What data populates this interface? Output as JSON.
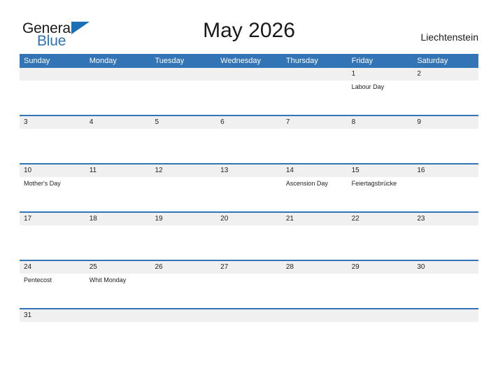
{
  "brand": {
    "word_one": "General",
    "word_two": "Blue",
    "triangle_icon": "triangle-right-icon",
    "blue_hex": "#2b73b8",
    "header_blue_hex": "#3274b6"
  },
  "header": {
    "title": "May 2026",
    "region": "Liechtenstein"
  },
  "calendar": {
    "weekday_headers": [
      "Sunday",
      "Monday",
      "Tuesday",
      "Wednesday",
      "Thursday",
      "Friday",
      "Saturday"
    ],
    "weeks": [
      {
        "days": [
          {
            "num": "",
            "events": ""
          },
          {
            "num": "",
            "events": ""
          },
          {
            "num": "",
            "events": ""
          },
          {
            "num": "",
            "events": ""
          },
          {
            "num": "",
            "events": ""
          },
          {
            "num": "1",
            "events": "Labour Day"
          },
          {
            "num": "2",
            "events": ""
          }
        ]
      },
      {
        "days": [
          {
            "num": "3",
            "events": ""
          },
          {
            "num": "4",
            "events": ""
          },
          {
            "num": "5",
            "events": ""
          },
          {
            "num": "6",
            "events": ""
          },
          {
            "num": "7",
            "events": ""
          },
          {
            "num": "8",
            "events": ""
          },
          {
            "num": "9",
            "events": ""
          }
        ]
      },
      {
        "days": [
          {
            "num": "10",
            "events": "Mother's Day"
          },
          {
            "num": "11",
            "events": ""
          },
          {
            "num": "12",
            "events": ""
          },
          {
            "num": "13",
            "events": ""
          },
          {
            "num": "14",
            "events": "Ascension Day"
          },
          {
            "num": "15",
            "events": "Feiertagsbrücke"
          },
          {
            "num": "16",
            "events": ""
          }
        ]
      },
      {
        "days": [
          {
            "num": "17",
            "events": ""
          },
          {
            "num": "18",
            "events": ""
          },
          {
            "num": "19",
            "events": ""
          },
          {
            "num": "20",
            "events": ""
          },
          {
            "num": "21",
            "events": ""
          },
          {
            "num": "22",
            "events": ""
          },
          {
            "num": "23",
            "events": ""
          }
        ]
      },
      {
        "days": [
          {
            "num": "24",
            "events": "Pentecost"
          },
          {
            "num": "25",
            "events": "Whit Monday"
          },
          {
            "num": "26",
            "events": ""
          },
          {
            "num": "27",
            "events": ""
          },
          {
            "num": "28",
            "events": ""
          },
          {
            "num": "29",
            "events": ""
          },
          {
            "num": "30",
            "events": ""
          }
        ]
      },
      {
        "days": [
          {
            "num": "31",
            "events": ""
          },
          {
            "num": "",
            "events": ""
          },
          {
            "num": "",
            "events": ""
          },
          {
            "num": "",
            "events": ""
          },
          {
            "num": "",
            "events": ""
          },
          {
            "num": "",
            "events": ""
          },
          {
            "num": "",
            "events": ""
          }
        ]
      }
    ]
  }
}
